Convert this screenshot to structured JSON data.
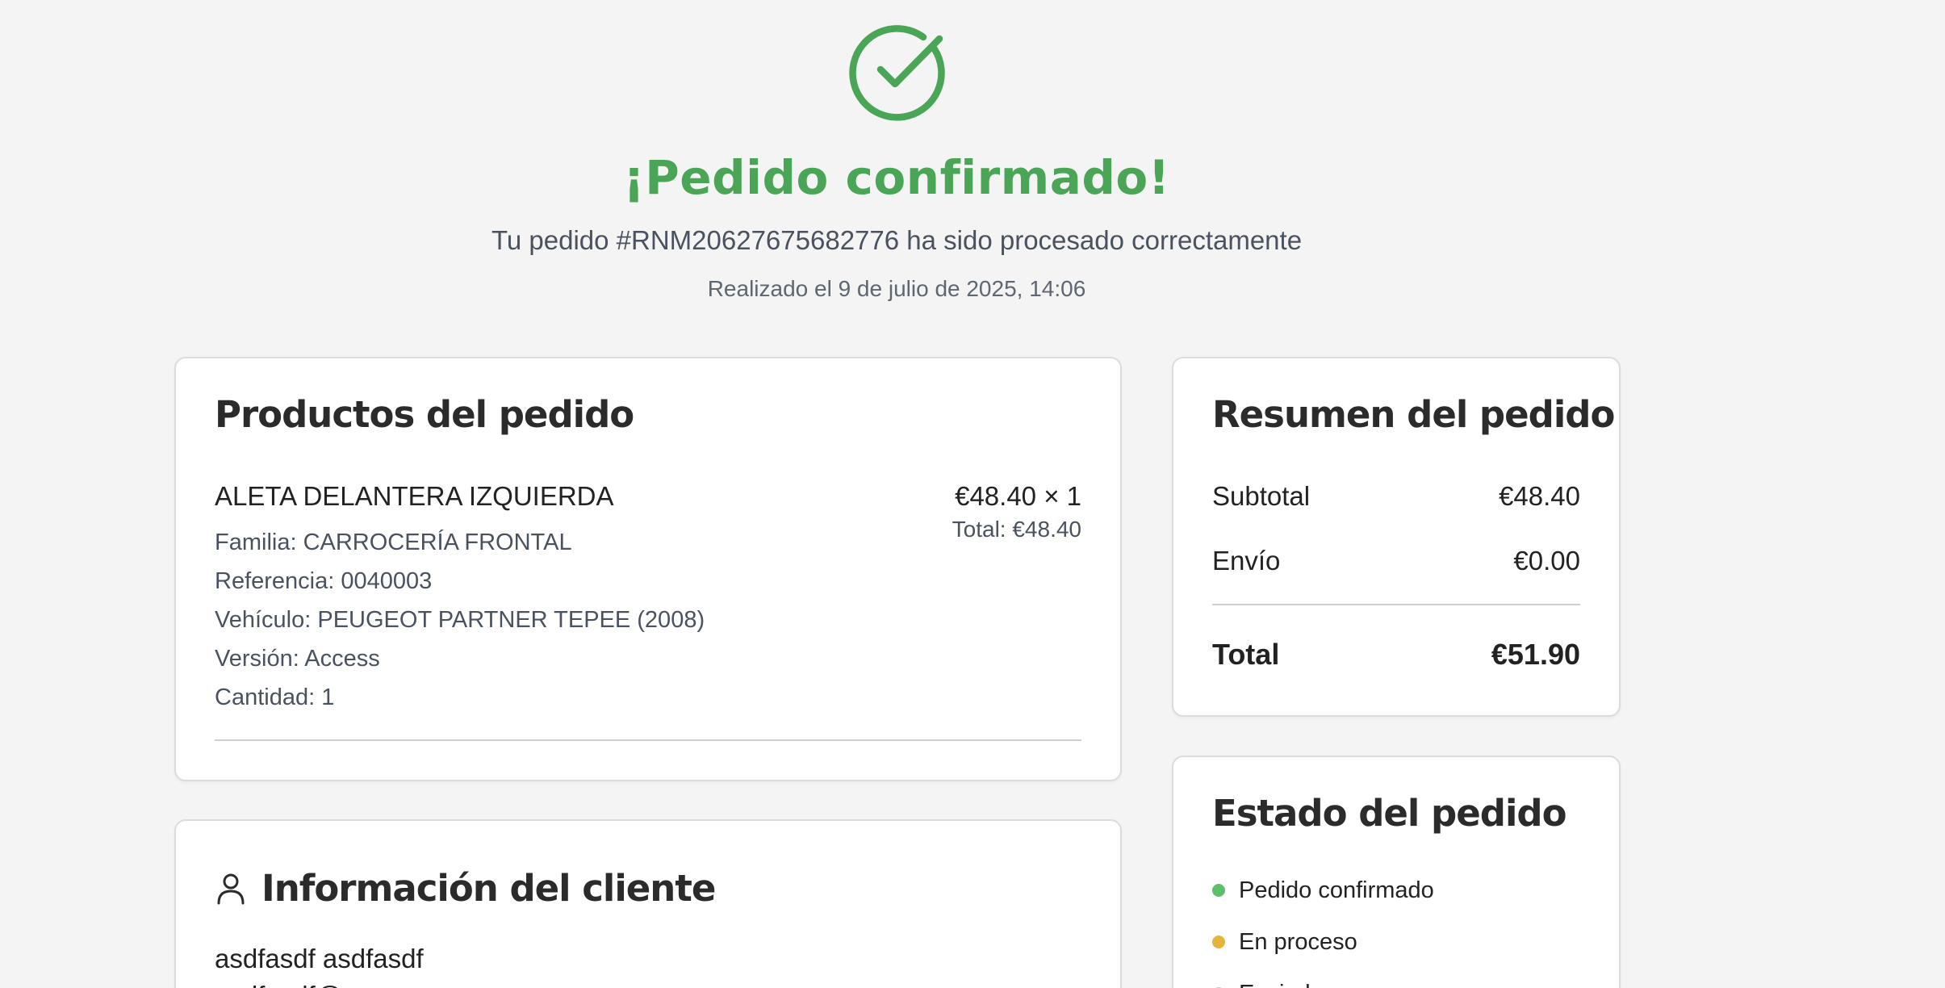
{
  "header": {
    "title": "¡Pedido confirmado!",
    "subtitle": "Tu pedido #RNM20627675682776 ha sido procesado correctamente",
    "date": "Realizado el 9 de julio de 2025, 14:06",
    "icon": "check-circle-icon",
    "accent_color": "#4aa556"
  },
  "products": {
    "title": "Productos del pedido",
    "items": [
      {
        "name": "ALETA DELANTERA IZQUIERDA",
        "price_line": "€48.40 × 1",
        "total_line": "Total: €48.40",
        "family": "Familia: CARROCERÍA FRONTAL",
        "reference": "Referencia: 0040003",
        "vehicle": "Vehículo: PEUGEOT PARTNER TEPEE (2008)",
        "version": "Versión: Access",
        "quantity": "Cantidad: 1"
      }
    ]
  },
  "customer": {
    "title": "Información del cliente",
    "icon": "user-icon",
    "name": "asdfasdf asdfasdf",
    "email": "asdfasdf@"
  },
  "summary": {
    "title": "Resumen del pedido",
    "subtotal_label": "Subtotal",
    "subtotal_value": "€48.40",
    "shipping_label": "Envío",
    "shipping_value": "€0.00",
    "total_label": "Total",
    "total_value": "€51.90"
  },
  "status": {
    "title": "Estado del pedido",
    "items": [
      {
        "label": "Pedido confirmado",
        "color": "#5cbf6a"
      },
      {
        "label": "En proceso",
        "color": "#e4b43c"
      },
      {
        "label": "Enviado",
        "color": "#c9c9c9"
      }
    ]
  }
}
